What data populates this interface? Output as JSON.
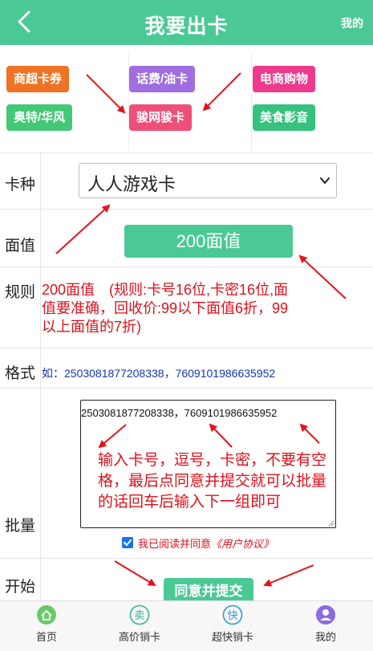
{
  "header": {
    "title": "我要出卡",
    "right_link": "我的",
    "back_icon": "chevron-left-icon"
  },
  "categories": [
    {
      "label": "商超卡券",
      "color": "#f07224"
    },
    {
      "label": "话费/油卡",
      "color": "#a06ee0"
    },
    {
      "label": "电商购物",
      "color": "#ee3a8e"
    },
    {
      "label": "奥特/华风",
      "color": "#43c875"
    },
    {
      "label": "骏网骏卡",
      "color": "#ee4f78"
    },
    {
      "label": "美食影音",
      "color": "#36c27e"
    }
  ],
  "form": {
    "card_type": {
      "label": "卡种",
      "value": "人人游戏卡"
    },
    "face_value": {
      "label": "面值",
      "value": "200面值"
    },
    "rules": {
      "label": "规则",
      "text": "200面值　(规则:卡号16位,卡密16位,面值要准确，回收价:99以下面值6折，99以上面值的7折)"
    },
    "format": {
      "label": "格式",
      "text": "如：2503081877208338，7609101986635952"
    },
    "batch": {
      "label": "批量",
      "value": "2503081877208338，7609101986635952",
      "note": "输入卡号，逗号，卡密，不要有空格，最后点同意并提交就可以批量的话回车后输入下一组即可"
    },
    "agreement": {
      "checked": true,
      "text": "我已阅读并同意",
      "link": "《用户协议》"
    },
    "start": {
      "label": "开始",
      "button": "同意并提交"
    }
  },
  "tabs": [
    {
      "label": "首页",
      "icon": "home-icon",
      "color": "#6bc96a"
    },
    {
      "label": "高价销卡",
      "icon": "sell-icon",
      "color": "#3ab38d"
    },
    {
      "label": "超快销卡",
      "icon": "fast-icon",
      "color": "#2f9ad6"
    },
    {
      "label": "我的",
      "icon": "user-icon",
      "color": "#8d6be0"
    }
  ],
  "colors": {
    "accent": "#4bc995",
    "note_red": "#e0101c",
    "format_blue": "#1435b5"
  }
}
